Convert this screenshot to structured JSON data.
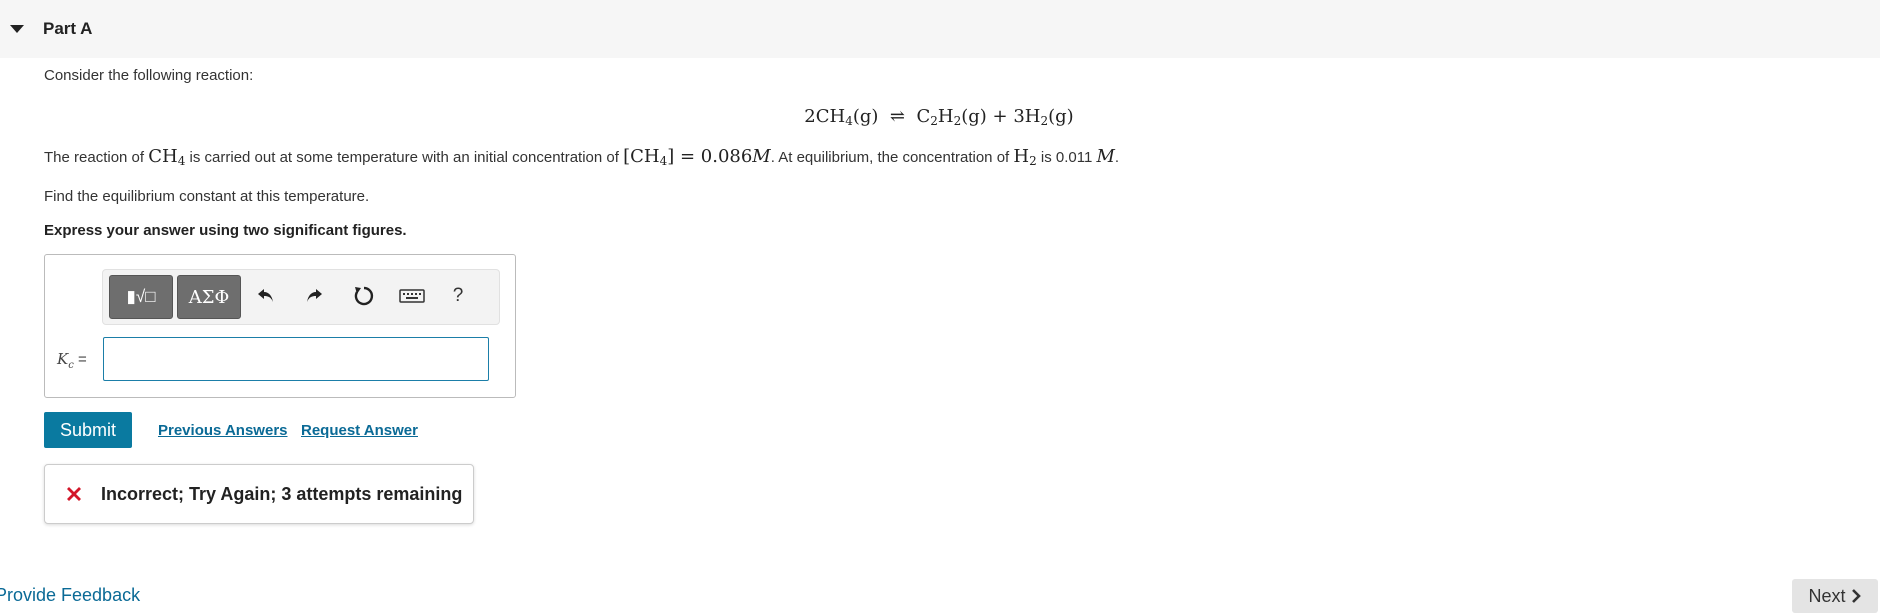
{
  "part": {
    "title": "Part A"
  },
  "prompt": {
    "intro": "Consider the following reaction:",
    "reaction": {
      "lhs_coef": "2",
      "lhs": "CH",
      "lhs_sub": "4",
      "lhs_state": "(g)",
      "arrow": "⇌",
      "rhs1": "C",
      "rhs1_sub1": "2",
      "rhs1_mid": "H",
      "rhs1_sub2": "2",
      "rhs1_state": "(g)",
      "plus": "+",
      "rhs2_coef": "3",
      "rhs2": "H",
      "rhs2_sub": "2",
      "rhs2_state": "(g)"
    },
    "line2": {
      "t1": "The reaction of ",
      "ch4": "CH",
      "ch4_sub": "4",
      "t2": " is carried out at some temperature with an initial concentration of ",
      "conc_open": "[CH",
      "conc_sub": "4",
      "conc_close": "] = 0.086",
      "unit_M": "M",
      "t3": ". At equilibrium, the concentration of ",
      "h2": "H",
      "h2_sub": "2",
      "t4": " is 0.011 ",
      "unit_M2": "M",
      "t5": "."
    },
    "find": "Find the equilibrium constant at this temperature.",
    "express": "Express your answer using two significant figures."
  },
  "toolbar": {
    "templates_label": "▮√□",
    "greek_label": "ΑΣΦ",
    "help_label": "?"
  },
  "answer": {
    "label_main": "K",
    "label_sub": "c",
    "label_eq": " =",
    "value": ""
  },
  "actions": {
    "submit": "Submit",
    "previous_answers": "Previous Answers",
    "request_answer": "Request Answer"
  },
  "feedback": {
    "message": "Incorrect; Try Again; 3 attempts remaining"
  },
  "footer": {
    "provide_feedback": "Provide Feedback",
    "next": "Next"
  },
  "colors": {
    "accent": "#0a7aa0",
    "link": "#0a6a96",
    "error": "#d3172a"
  }
}
